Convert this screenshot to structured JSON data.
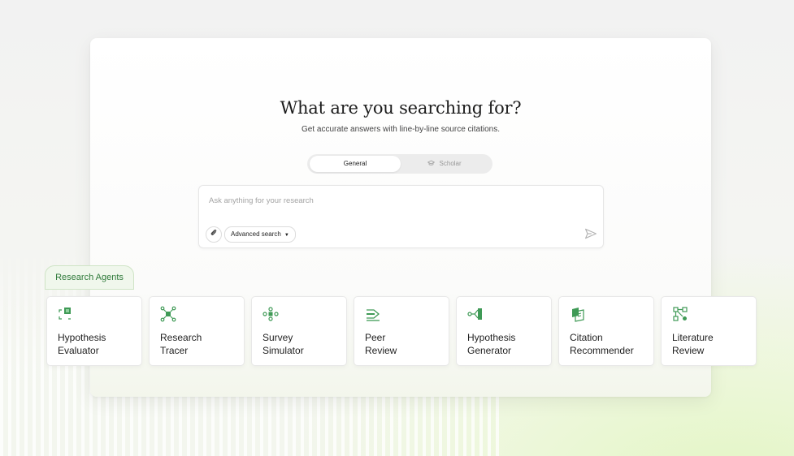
{
  "hero": {
    "title": "What are you searching for?",
    "subtitle": "Get accurate answers with line-by-line source citations."
  },
  "mode_toggle": {
    "options": [
      "General",
      "Scholar"
    ],
    "selected": "General"
  },
  "search": {
    "placeholder": "Ask anything for your research",
    "value": "",
    "advanced_label": "Advanced search"
  },
  "agents": {
    "tab_label": "Research Agents",
    "items": [
      {
        "line1": "Hypothesis",
        "line2": "Evaluator",
        "icon": "hypothesis-evaluator-icon"
      },
      {
        "line1": "Research",
        "line2": "Tracer",
        "icon": "research-tracer-icon"
      },
      {
        "line1": "Survey",
        "line2": "Simulator",
        "icon": "survey-simulator-icon"
      },
      {
        "line1": "Peer",
        "line2": "Review",
        "icon": "peer-review-icon"
      },
      {
        "line1": "Hypothesis",
        "line2": "Generator",
        "icon": "hypothesis-generator-icon"
      },
      {
        "line1": "Citation",
        "line2": "Recommender",
        "icon": "citation-recommender-icon"
      },
      {
        "line1": "Literature",
        "line2": "Review",
        "icon": "literature-review-icon"
      }
    ]
  },
  "colors": {
    "accent_green": "#2f8a44",
    "tab_bg": "#f0f7ec"
  }
}
